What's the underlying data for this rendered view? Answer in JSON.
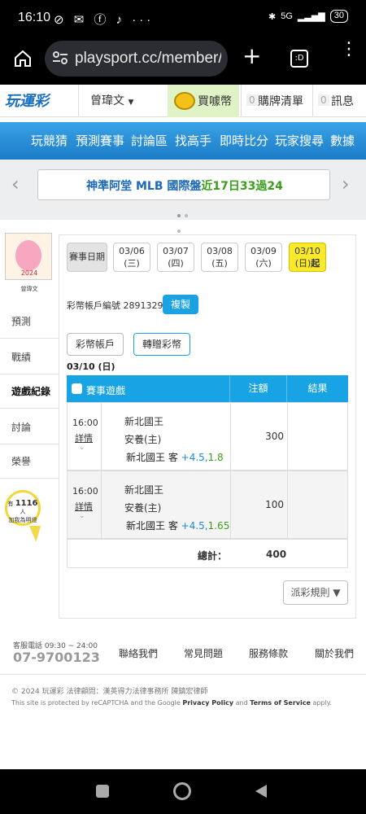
{
  "status_bar": {
    "time": "16:10",
    "battery": "30",
    "network": "5G"
  },
  "browser": {
    "url": "playsport.cc/member/"
  },
  "header": {
    "logo": "玩運彩",
    "username": "曾瑋文",
    "coin_label": "買噱幣",
    "cart_count": "0",
    "cart_label": "購牌清單",
    "msg_count": "0",
    "msg_label": "訊息"
  },
  "nav": {
    "items": [
      "玩競猜",
      "預測賽事",
      "討論區",
      "找高手",
      "即時比分",
      "玩家搜尋",
      "數據"
    ]
  },
  "banner": {
    "text_prefix": "神準阿堂 MLB 國際盤",
    "text_suffix": "近17日33過24"
  },
  "sidebar": {
    "avatar_text": "2024",
    "username": "曾瑋文",
    "items": [
      "預測",
      "戰績",
      "遊戲紀錄",
      "討論",
      "榮譽"
    ],
    "bubble_prefix": "有",
    "bubble_count": "1116",
    "bubble_suffix": "人",
    "bubble_sub": "加我為明燈"
  },
  "main": {
    "date_label": "賽事日期",
    "dates": [
      {
        "date": "03/06",
        "day": "(三)"
      },
      {
        "date": "03/07",
        "day": "(四)"
      },
      {
        "date": "03/08",
        "day": "(五)"
      },
      {
        "date": "03/09",
        "day": "(六)"
      },
      {
        "date": "03/10",
        "day": "(日)",
        "tag": "起"
      }
    ],
    "account_text": "彩幣帳戶編號 28913297",
    "copy_button": "複製",
    "tab_account": "彩幣帳戶",
    "tab_transfer": "轉贈彩幣",
    "current_date": "03/10 (日)",
    "table": {
      "headers": [
        "賽事遊戲",
        "注額",
        "結果"
      ],
      "rows": [
        {
          "time": "16:00",
          "detail": "詳情",
          "away": "新北國王",
          "home": "安養(主)",
          "pick": "新北國王 客",
          "line": "+4.5,",
          "odds": "1.8",
          "amount": "300"
        },
        {
          "time": "16:00",
          "detail": "詳情",
          "away": "新北國王",
          "home": "安養(主)",
          "pick": "新北國王 客",
          "line": "+4.5,",
          "odds": "1.65",
          "amount": "100"
        }
      ],
      "total_label": "總計：",
      "total_value": "400"
    },
    "rules_button": "派彩規則 ▼"
  },
  "footer": {
    "hotline_label": "客服電話 09:30 ~ 24:00",
    "hotline": "07-9700123",
    "links": [
      "聯絡我們",
      "常見問題",
      "服務條款",
      "關於我們"
    ],
    "copyright": "© 2024 玩運彩 法律顧問：漢英得力法律事務所 陳鎮宏律師",
    "captcha_prefix": "This site is protected by reCAPTCHA and the Google ",
    "privacy": "Privacy Policy",
    "and": " and ",
    "terms": "Terms of Service",
    "apply": " apply."
  },
  "colors": {
    "accent": "#1aa2e3",
    "nav": "#2a8fd6",
    "highlight": "#f8e92b",
    "green": "#3a9e1a"
  }
}
